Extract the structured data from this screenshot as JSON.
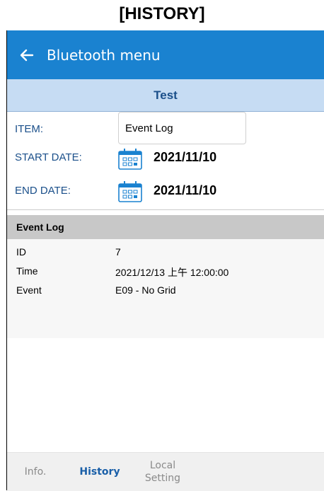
{
  "caption": "[HISTORY]",
  "appbar": {
    "title": "Bluetooth menu"
  },
  "subheader": {
    "title": "Test"
  },
  "form": {
    "item_label": "ITEM:",
    "item_value": "Event Log",
    "start_label": "START DATE:",
    "start_value": "2021/11/10",
    "end_label": "END DATE:",
    "end_value": "2021/11/10"
  },
  "section": {
    "title": "Event Log"
  },
  "details": [
    {
      "key": "ID",
      "value": "7"
    },
    {
      "key": "Time",
      "value": "2021/12/13 上午 12:00:00"
    },
    {
      "key": "Event",
      "value": "E09 - No Grid"
    }
  ],
  "tabs": [
    {
      "label": "Info.",
      "state": "inactive"
    },
    {
      "label": "History",
      "state": "active"
    },
    {
      "label": "Local\nSetting",
      "state": "inactive"
    }
  ],
  "colors": {
    "primary": "#1a82d0",
    "subheader": "#c6dcf3",
    "label": "#1a4f8a"
  }
}
